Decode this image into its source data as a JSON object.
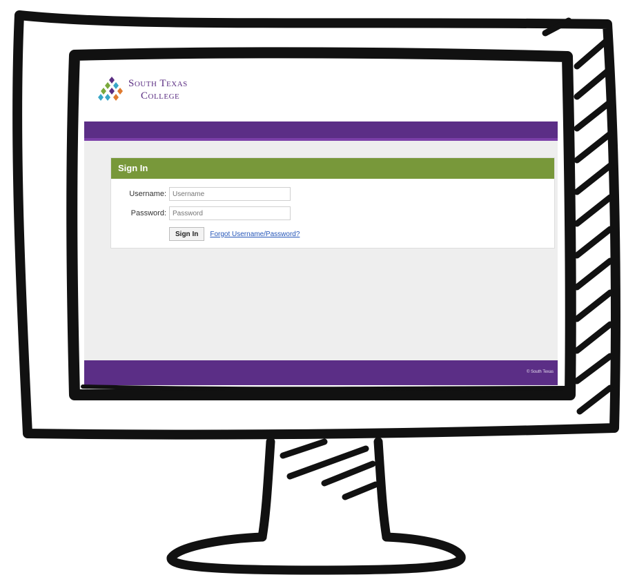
{
  "brand": {
    "name_line1": "South Texas",
    "name_line2": "College",
    "logo_colors": [
      "#5a2d82",
      "#7aa93c",
      "#38a7c7",
      "#e07b2f"
    ]
  },
  "colors": {
    "header_purple": "#5b2e86",
    "panel_green": "#78983a",
    "content_bg": "#eeeeee",
    "link_blue": "#2455b8"
  },
  "signin": {
    "panel_title": "Sign In",
    "username_label": "Username:",
    "username_placeholder": "Username",
    "password_label": "Password:",
    "password_placeholder": "Password",
    "button_label": "Sign In",
    "forgot_link": "Forgot Username/Password?"
  },
  "footer": {
    "text": "© South Texas"
  },
  "icons": {
    "logo": "diamond-cluster-logo-icon",
    "monitor": "hand-drawn-monitor-frame"
  }
}
